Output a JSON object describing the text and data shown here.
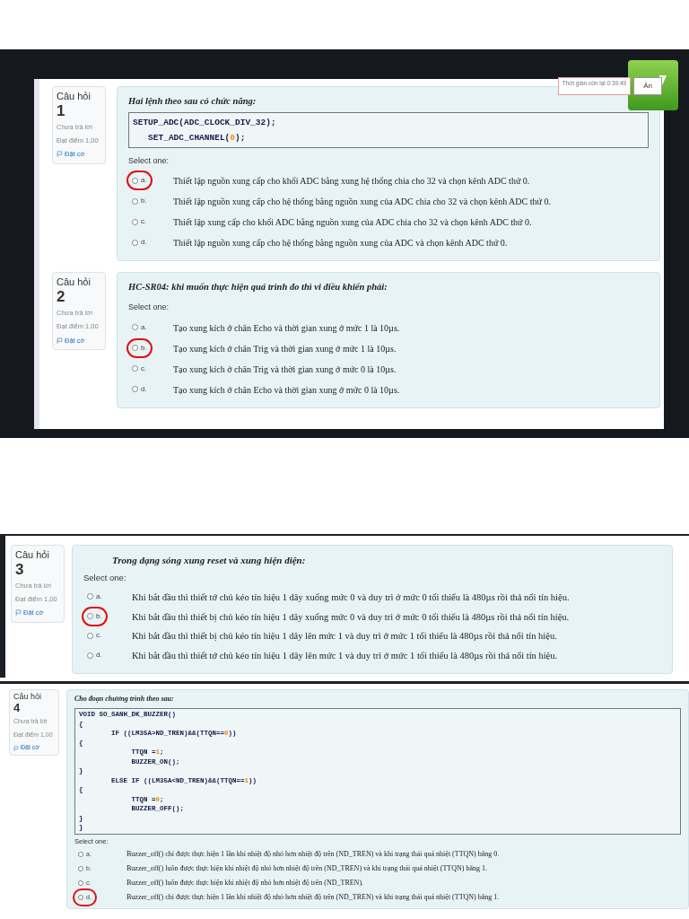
{
  "sections": [
    {
      "kind": "framed",
      "timer": "Thời gian còn lại 0:39:49",
      "hide_button": "Ẩn",
      "questions": [
        {
          "label": "Câu hỏi",
          "number": "1",
          "status": "Chưa trả lời",
          "score": "Đạt điểm 1,00",
          "flag": "Đặt cờ",
          "prompt": "Hai lệnh theo sau có chức năng:",
          "code": [
            [
              {
                "text": "SETUP_ADC(ADC_CLOCK_DIV_32);",
                "kind": "text"
              }
            ],
            [
              {
                "text": "   SET_ADC_CHANNEL(",
                "kind": "text"
              },
              {
                "text": "0",
                "kind": "num"
              },
              {
                "text": ");",
                "kind": "text"
              }
            ]
          ],
          "select_label": "Select one:",
          "options": [
            {
              "letter": "a.",
              "text": "Thiết lập nguồn xung cấp cho khối ADC bằng xung hệ thống chia cho 32 và chọn kênh ADC thứ 0.",
              "selected": false,
              "circled": true
            },
            {
              "letter": "b.",
              "text": "Thiết lập nguồn xung cấp cho hệ thống bằng nguồn xung của ADC chia cho 32 và chọn kênh ADC thứ 0.",
              "selected": false,
              "circled": false
            },
            {
              "letter": "c.",
              "text": "Thiết lập xung cấp cho khối ADC bằng nguồn xung của ADC chia cho 32 và chọn kênh ADC thứ 0.",
              "selected": false,
              "circled": false
            },
            {
              "letter": "d.",
              "text": "Thiết lập nguồn xung cấp cho hệ thống bằng nguồn xung của ADC và chọn kênh ADC thứ 0.",
              "selected": false,
              "circled": false
            }
          ]
        },
        {
          "label": "Câu hỏi",
          "number": "2",
          "status": "Chưa trả lời",
          "score": "Đạt điểm 1,00",
          "flag": "Đặt cờ",
          "prompt": "HC-SR04: khi muốn thực hiện quá trình đo thì vi điều khiển phải:",
          "select_label": "Select one:",
          "options": [
            {
              "letter": "a.",
              "text": "Tạo xung kích ở chân Echo và thời gian xung ở mức 1 là 10µs.",
              "selected": false,
              "circled": false
            },
            {
              "letter": "b.",
              "text": "Tạo xung kích ở chân Trig và thời gian xung ở mức 1 là 10µs.",
              "selected": false,
              "circled": true
            },
            {
              "letter": "c.",
              "text": "Tạo xung kích ở chân Trig và thời gian xung ở mức 0 là 10µs.",
              "selected": false,
              "circled": false
            },
            {
              "letter": "d.",
              "text": "Tạo xung kích ở chân Echo và thời gian xung ở mức 0 là 10µs.",
              "selected": false,
              "circled": false
            }
          ]
        }
      ]
    },
    {
      "kind": "plain",
      "questions": [
        {
          "label": "Câu hỏi",
          "number": "3",
          "status": "Chưa trả lời",
          "score": "Đạt điểm 1,00",
          "flag": "Đặt cờ",
          "prompt": "Trong dạng sóng xung reset và xung hiện diện:",
          "select_label": "Select one:",
          "options": [
            {
              "letter": "a.",
              "text": "Khi bắt đầu thì thiết tớ chủ kéo tín hiệu 1 dây xuống mức 0 và duy trì ở mức 0 tối thiểu là 480µs rồi thả nổi tín hiệu.",
              "selected": false,
              "circled": false
            },
            {
              "letter": "b.",
              "text": "Khi bắt đầu thì thiết bị chủ kéo tín hiệu 1 dây xuống mức 0 và duy trì ở mức 0 tối thiểu là 480µs rồi thả nổi tín hiệu.",
              "selected": false,
              "circled": true
            },
            {
              "letter": "c.",
              "text": "Khi bắt đầu thì thiết bị chủ kéo tín hiệu 1 dây lên mức 1 và duy trì ở mức 1 tối thiểu là 480µs rồi thả nổi tín hiệu.",
              "selected": false,
              "circled": false
            },
            {
              "letter": "d.",
              "text": "Khi bắt đầu thì thiết tớ chủ kéo tín hiệu 1 dây lên mức 1 và duy trì ở mức 1 tối thiểu là 480µs rồi thả nổi tín hiệu.",
              "selected": false,
              "circled": false
            }
          ]
        }
      ]
    },
    {
      "kind": "compact",
      "questions": [
        {
          "label": "Câu hỏi",
          "number": "4",
          "status": "Chưa trả lời",
          "score": "Đạt điểm 1,00",
          "flag": "Đặt cờ",
          "prompt": "Cho đoạn chương trình theo sau:",
          "code": [
            [
              {
                "text": "VOID SO_SANH_DK_BUZZER()",
                "kind": "text"
              }
            ],
            [
              {
                "text": "{",
                "kind": "text"
              }
            ],
            [
              {
                "text": "        IF ((LM35A>ND_TREN)&&(TTQN==",
                "kind": "text"
              },
              {
                "text": "0",
                "kind": "num"
              },
              {
                "text": "))",
                "kind": "text"
              }
            ],
            [
              {
                "text": "{",
                "kind": "text"
              }
            ],
            [
              {
                "text": "             TTQN =",
                "kind": "text"
              },
              {
                "text": "1",
                "kind": "num"
              },
              {
                "text": ";",
                "kind": "text"
              }
            ],
            [
              {
                "text": "             BUZZER_ON();",
                "kind": "text"
              }
            ],
            [
              {
                "text": "}",
                "kind": "text"
              }
            ],
            [
              {
                "text": "        ELSE IF ((LM35A<ND_TREN)&&(TTQN==",
                "kind": "text"
              },
              {
                "text": "1",
                "kind": "num"
              },
              {
                "text": "))",
                "kind": "text"
              }
            ],
            [
              {
                "text": "{",
                "kind": "text"
              }
            ],
            [
              {
                "text": "             TTQN =",
                "kind": "text"
              },
              {
                "text": "0",
                "kind": "num"
              },
              {
                "text": ";",
                "kind": "text"
              }
            ],
            [
              {
                "text": "             BUZZER_OFF();",
                "kind": "text"
              }
            ],
            [
              {
                "text": "}",
                "kind": "text"
              }
            ],
            [
              {
                "text": "}",
                "kind": "text"
              }
            ]
          ],
          "select_label": "Select one:",
          "options": [
            {
              "letter": "a.",
              "text": "Buzzer_off() chỉ được thực hiện 1 lần khi nhiệt độ nhỏ hơn nhiệt độ trên  (ND_TREN) và khi trạng thái quá nhiệt (TTQN) bằng 0.",
              "selected": false,
              "circled": false
            },
            {
              "letter": "b.",
              "text": "Buzzer_off() luôn được thực hiện khi nhiệt độ nhỏ hơn nhiệt độ trên  (ND_TREN) và khi trạng thái quá nhiệt (TTQN) bằng 1.",
              "selected": false,
              "circled": false
            },
            {
              "letter": "c.",
              "text": "Buzzer_off() luôn được thực hiện khi nhiệt độ nhỏ hơn nhiệt độ trên  (ND_TREN).",
              "selected": false,
              "circled": false
            },
            {
              "letter": "d.",
              "text": "Buzzer_off() chỉ được thực hiện 1 lần khi nhiệt độ nhỏ hơn nhiệt độ trên  (ND_TREN) và khi trạng thái quá nhiệt (TTQN) bằng 1.",
              "selected": false,
              "circled": true
            }
          ]
        }
      ]
    }
  ]
}
